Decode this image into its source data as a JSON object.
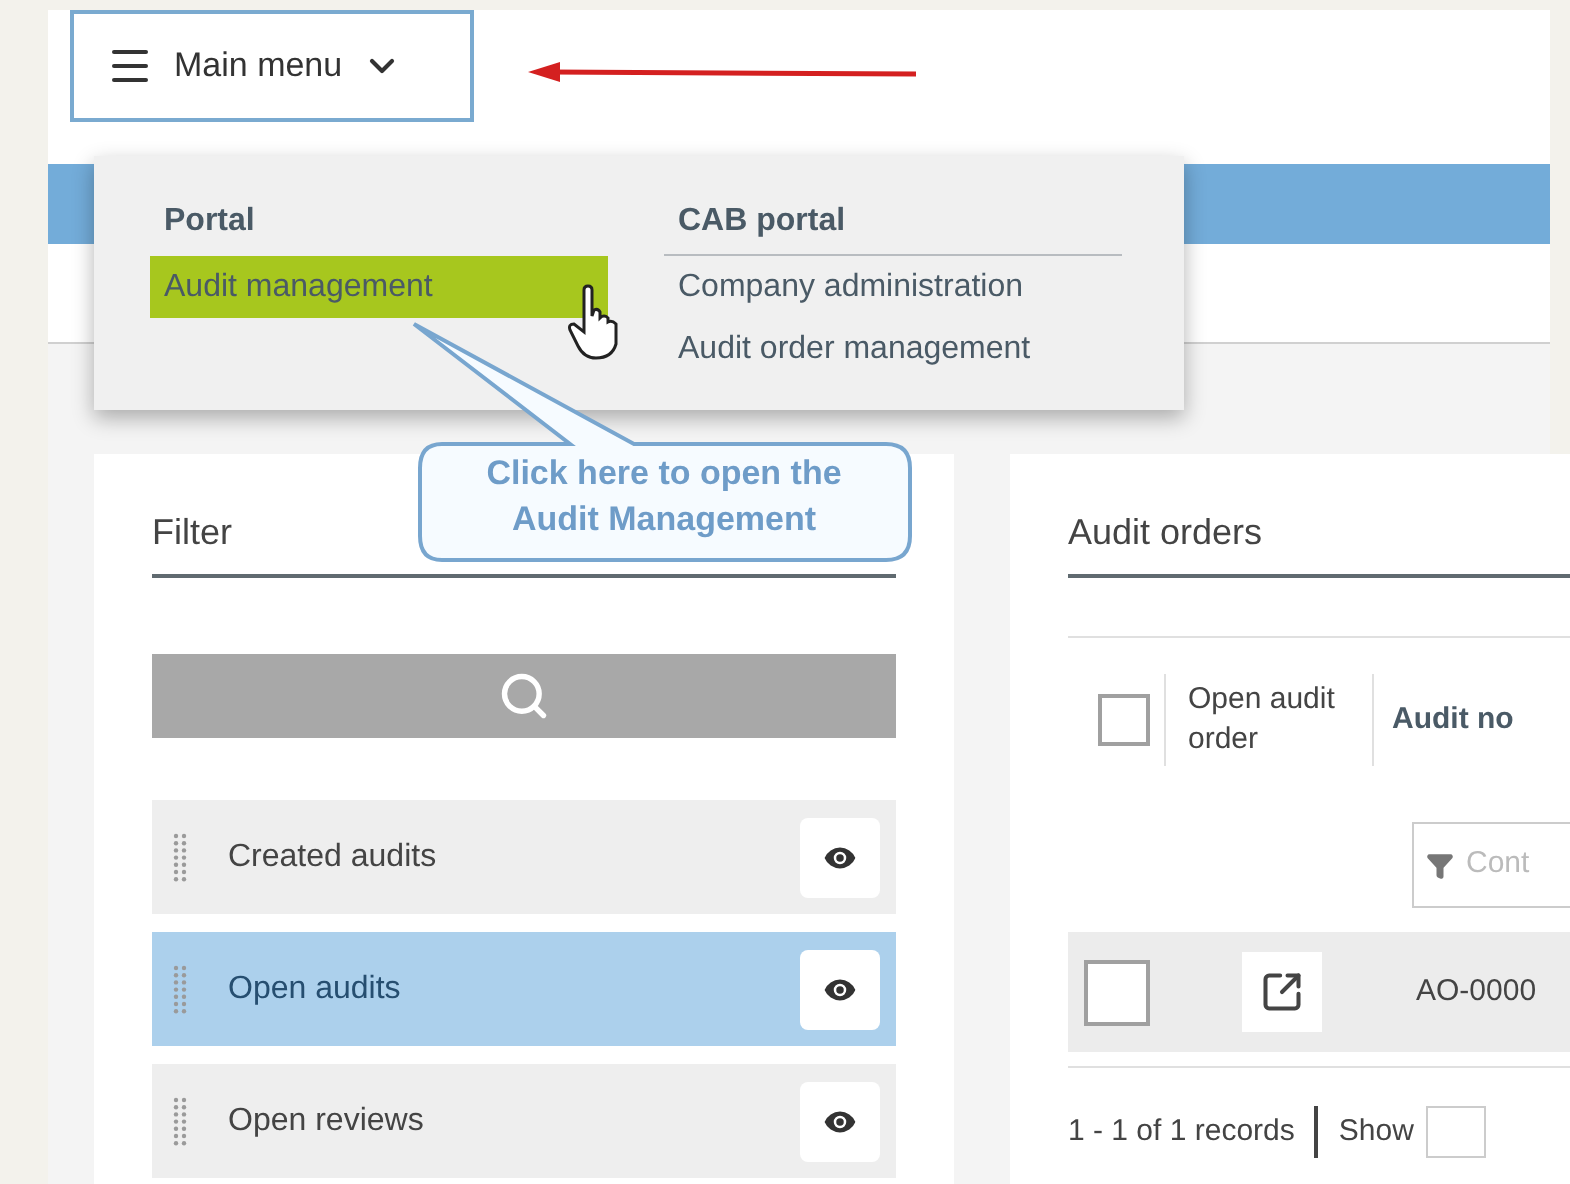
{
  "main_menu": {
    "label": "Main menu",
    "expanded": true
  },
  "menu": {
    "columns": [
      {
        "heading": "Portal",
        "items": [
          {
            "label": "Audit management",
            "selected": true
          }
        ]
      },
      {
        "heading": "CAB portal",
        "items": [
          {
            "label": "Company administration",
            "selected": false
          },
          {
            "label": "Audit order management",
            "selected": false
          }
        ]
      }
    ]
  },
  "callout": {
    "lines": [
      "Click here to open the",
      "Audit Management"
    ]
  },
  "filter": {
    "title": "Filter",
    "items": [
      {
        "label": "Created audits",
        "selected": false
      },
      {
        "label": "Open audits",
        "selected": true
      },
      {
        "label": "Open reviews",
        "selected": false
      }
    ]
  },
  "audit_orders": {
    "title": "Audit orders",
    "select_all_checked": false,
    "columns": [
      "Open audit order",
      "Audit no"
    ],
    "filter_placeholder": "Cont",
    "rows": [
      {
        "checked": false,
        "audit_no": "AO-0000"
      }
    ],
    "footer": {
      "records": "1 - 1 of 1 records",
      "show_label": "Show"
    }
  }
}
